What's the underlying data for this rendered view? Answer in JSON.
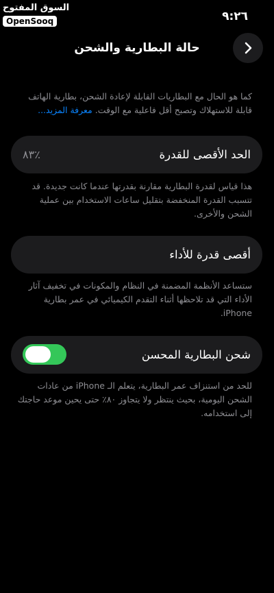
{
  "status_bar": {
    "time": "٩:٢٦"
  },
  "watermark": {
    "arabic": "السوق المفتوح",
    "english": "OpenSooq"
  },
  "header": {
    "title": "حالة البطارية والشحن"
  },
  "intro": {
    "text": "كما هو الحال مع البطاريات القابلة لإعادة الشحن، بطارية الهاتف قابلة للاستهلاك وتصبح أقل فاعلية مع الوقت.",
    "link_label": "معرفة المزيد..."
  },
  "max_capacity": {
    "label": "الحد الأقصى للقدرة",
    "value": "٪٨٣",
    "description": "هذا قياس لقدرة البطارية مقارنة بقدرتها عندما كانت جديدة. قد تتسبب القدرة المنخفضة بتقليل ساعات الاستخدام بين عملية الشحن والأخرى."
  },
  "peak_performance": {
    "label": "أقصى قدرة للأداء",
    "description": "ستساعد الأنظمة المضمنة في النظام والمكونات في تخفيف آثار الأداء التي قد تلاحظها أثناء التقدم الكيميائي في عمر بطارية iPhone."
  },
  "optimized_charging": {
    "label": "شحن البطارية المحسن",
    "enabled": true,
    "description": "للحد من استنزاف عمر البطارية، يتعلم الـ iPhone من عادات الشحن اليومية، بحيث ينتظر ولا يتجاوز ٨٠٪ حتى يحين موعد حاجتك إلى استخدامه."
  },
  "colors": {
    "background": "#000000",
    "card": "#1c1c1e",
    "secondary_text": "#8e8e93",
    "link": "#0a84ff",
    "toggle_on": "#34c759"
  }
}
